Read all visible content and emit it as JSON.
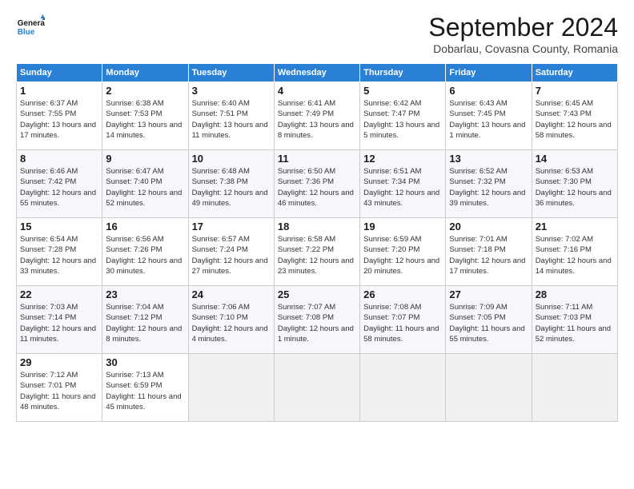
{
  "logo": {
    "line1": "General",
    "line2": "Blue"
  },
  "title": "September 2024",
  "location": "Dobarlau, Covasna County, Romania",
  "headers": [
    "Sunday",
    "Monday",
    "Tuesday",
    "Wednesday",
    "Thursday",
    "Friday",
    "Saturday"
  ],
  "weeks": [
    [
      {
        "day": "1",
        "info": "Sunrise: 6:37 AM\nSunset: 7:55 PM\nDaylight: 13 hours and 17 minutes."
      },
      {
        "day": "2",
        "info": "Sunrise: 6:38 AM\nSunset: 7:53 PM\nDaylight: 13 hours and 14 minutes."
      },
      {
        "day": "3",
        "info": "Sunrise: 6:40 AM\nSunset: 7:51 PM\nDaylight: 13 hours and 11 minutes."
      },
      {
        "day": "4",
        "info": "Sunrise: 6:41 AM\nSunset: 7:49 PM\nDaylight: 13 hours and 8 minutes."
      },
      {
        "day": "5",
        "info": "Sunrise: 6:42 AM\nSunset: 7:47 PM\nDaylight: 13 hours and 5 minutes."
      },
      {
        "day": "6",
        "info": "Sunrise: 6:43 AM\nSunset: 7:45 PM\nDaylight: 13 hours and 1 minute."
      },
      {
        "day": "7",
        "info": "Sunrise: 6:45 AM\nSunset: 7:43 PM\nDaylight: 12 hours and 58 minutes."
      }
    ],
    [
      {
        "day": "8",
        "info": "Sunrise: 6:46 AM\nSunset: 7:42 PM\nDaylight: 12 hours and 55 minutes."
      },
      {
        "day": "9",
        "info": "Sunrise: 6:47 AM\nSunset: 7:40 PM\nDaylight: 12 hours and 52 minutes."
      },
      {
        "day": "10",
        "info": "Sunrise: 6:48 AM\nSunset: 7:38 PM\nDaylight: 12 hours and 49 minutes."
      },
      {
        "day": "11",
        "info": "Sunrise: 6:50 AM\nSunset: 7:36 PM\nDaylight: 12 hours and 46 minutes."
      },
      {
        "day": "12",
        "info": "Sunrise: 6:51 AM\nSunset: 7:34 PM\nDaylight: 12 hours and 43 minutes."
      },
      {
        "day": "13",
        "info": "Sunrise: 6:52 AM\nSunset: 7:32 PM\nDaylight: 12 hours and 39 minutes."
      },
      {
        "day": "14",
        "info": "Sunrise: 6:53 AM\nSunset: 7:30 PM\nDaylight: 12 hours and 36 minutes."
      }
    ],
    [
      {
        "day": "15",
        "info": "Sunrise: 6:54 AM\nSunset: 7:28 PM\nDaylight: 12 hours and 33 minutes."
      },
      {
        "day": "16",
        "info": "Sunrise: 6:56 AM\nSunset: 7:26 PM\nDaylight: 12 hours and 30 minutes."
      },
      {
        "day": "17",
        "info": "Sunrise: 6:57 AM\nSunset: 7:24 PM\nDaylight: 12 hours and 27 minutes."
      },
      {
        "day": "18",
        "info": "Sunrise: 6:58 AM\nSunset: 7:22 PM\nDaylight: 12 hours and 23 minutes."
      },
      {
        "day": "19",
        "info": "Sunrise: 6:59 AM\nSunset: 7:20 PM\nDaylight: 12 hours and 20 minutes."
      },
      {
        "day": "20",
        "info": "Sunrise: 7:01 AM\nSunset: 7:18 PM\nDaylight: 12 hours and 17 minutes."
      },
      {
        "day": "21",
        "info": "Sunrise: 7:02 AM\nSunset: 7:16 PM\nDaylight: 12 hours and 14 minutes."
      }
    ],
    [
      {
        "day": "22",
        "info": "Sunrise: 7:03 AM\nSunset: 7:14 PM\nDaylight: 12 hours and 11 minutes."
      },
      {
        "day": "23",
        "info": "Sunrise: 7:04 AM\nSunset: 7:12 PM\nDaylight: 12 hours and 8 minutes."
      },
      {
        "day": "24",
        "info": "Sunrise: 7:06 AM\nSunset: 7:10 PM\nDaylight: 12 hours and 4 minutes."
      },
      {
        "day": "25",
        "info": "Sunrise: 7:07 AM\nSunset: 7:08 PM\nDaylight: 12 hours and 1 minute."
      },
      {
        "day": "26",
        "info": "Sunrise: 7:08 AM\nSunset: 7:07 PM\nDaylight: 11 hours and 58 minutes."
      },
      {
        "day": "27",
        "info": "Sunrise: 7:09 AM\nSunset: 7:05 PM\nDaylight: 11 hours and 55 minutes."
      },
      {
        "day": "28",
        "info": "Sunrise: 7:11 AM\nSunset: 7:03 PM\nDaylight: 11 hours and 52 minutes."
      }
    ],
    [
      {
        "day": "29",
        "info": "Sunrise: 7:12 AM\nSunset: 7:01 PM\nDaylight: 11 hours and 48 minutes."
      },
      {
        "day": "30",
        "info": "Sunrise: 7:13 AM\nSunset: 6:59 PM\nDaylight: 11 hours and 45 minutes."
      },
      null,
      null,
      null,
      null,
      null
    ]
  ]
}
